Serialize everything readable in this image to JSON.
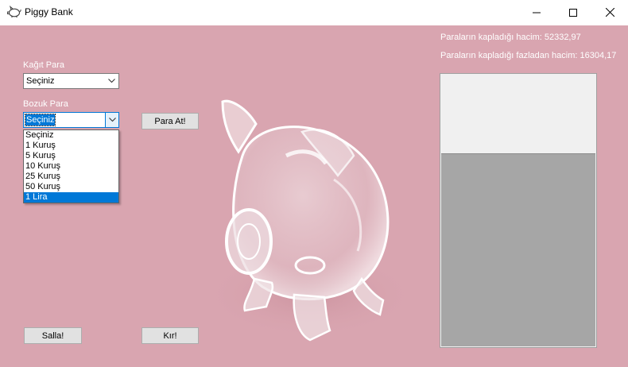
{
  "window": {
    "title": "Piggy Bank",
    "minimize_glyph": "—",
    "maximize_glyph": "☐",
    "close_glyph": "✕"
  },
  "paper_money": {
    "label": "Kağıt Para",
    "selected": "Seçiniz"
  },
  "coin": {
    "label": "Bozuk Para",
    "selected": "Seçiniz",
    "options": [
      "Seçiniz",
      "1 Kuruş",
      "5 Kuruş",
      "10 Kuruş",
      "25 Kuruş",
      "50 Kuruş",
      "1 Lira"
    ],
    "highlighted_option": "1 Lira"
  },
  "buttons": {
    "drop_money": "Para At!",
    "shake": "Salla!",
    "break": "Kır!"
  },
  "stats": {
    "volume_line": "Paraların kapladığı hacim: 52332,97",
    "overflow_line": "Paraların kapladığı fazladan hacim: 16304,17"
  },
  "fill_fraction": 0.71,
  "colors": {
    "background": "#d9a5b0",
    "highlight": "#0078d7",
    "fill": "#a6a6a6"
  },
  "icons": {
    "app": "piggy-bank-icon",
    "combo_arrow": "chevron-down-icon"
  }
}
